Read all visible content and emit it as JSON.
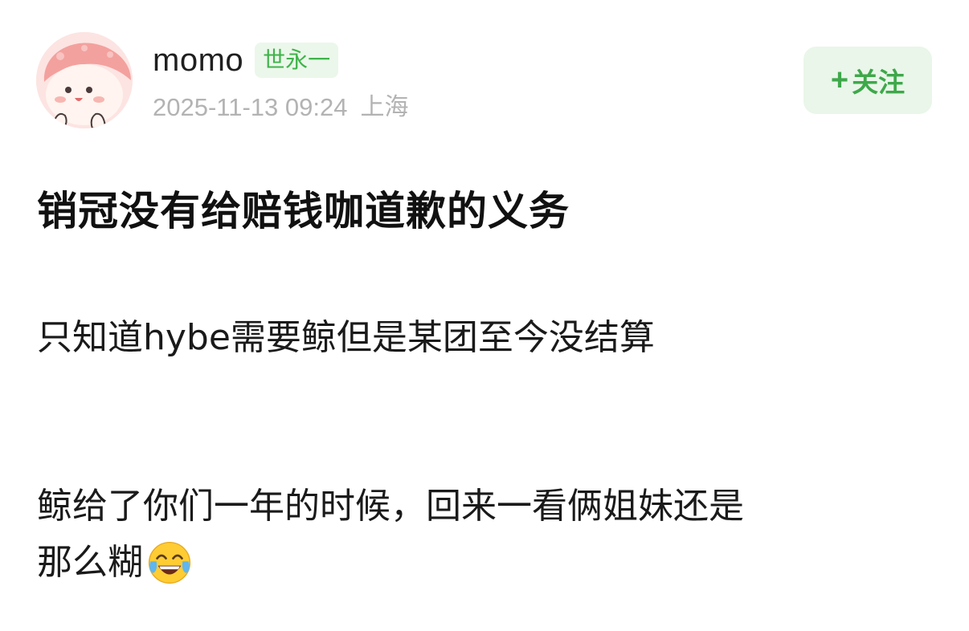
{
  "author": {
    "name": "momo",
    "badge": "世永一"
  },
  "meta": {
    "datetime": "2025-11-13 09:24",
    "location": "上海"
  },
  "follow_button": {
    "icon": "plus-icon",
    "plus": "+",
    "label": "关注"
  },
  "post": {
    "title": "销冠没有给赔钱咖道歉的义务",
    "paragraphs": [
      "只知道hybe需要鲸但是某团至今没结算",
      "鲸给了你们一年的时候，回来一看俩姐妹还是",
      "那么糊"
    ],
    "trailing_emoji": "face-with-tears-of-joy-icon"
  },
  "colors": {
    "accent_green": "#3ea84a",
    "badge_bg": "#ebf7ea",
    "follow_bg": "#e9f6e9",
    "meta_gray": "#b3b3b3",
    "avatar_pink": "#f4a3a1"
  }
}
